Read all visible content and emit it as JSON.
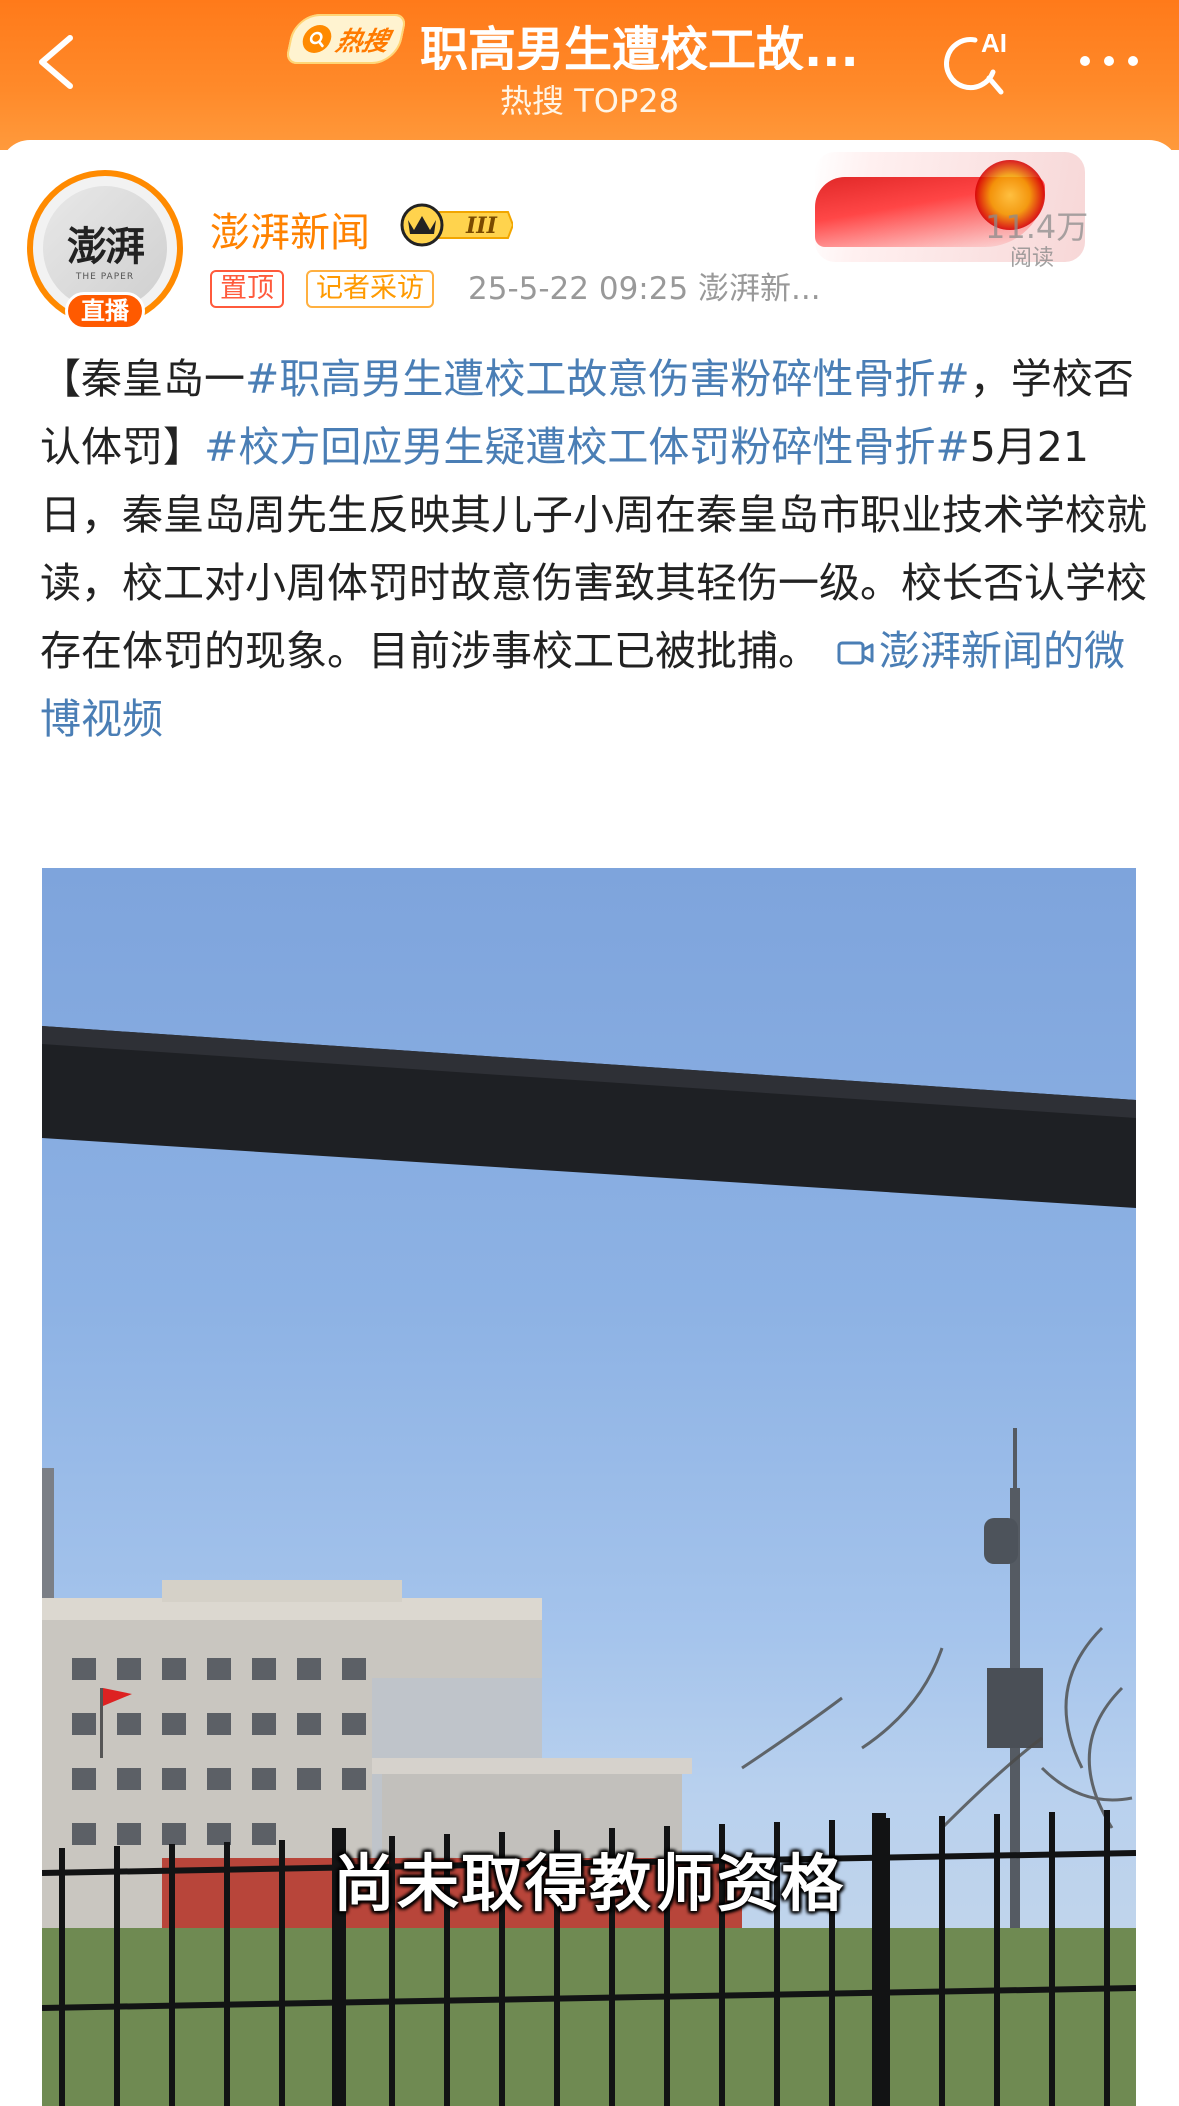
{
  "header": {
    "hot_badge": "热搜",
    "title": "职高男生遭校工故...",
    "subtitle": "热搜 TOP28",
    "ai_label": "AI"
  },
  "post": {
    "author": "澎湃新闻",
    "avatar_text": "澎湃",
    "avatar_subtext": "THE PAPER",
    "live_badge": "直播",
    "vip_level": "III",
    "tag_pin": "置顶",
    "tag_reporter": "记者采访",
    "meta": "25-5-22 09:25  澎湃新...",
    "read_count": "11.4万",
    "read_label": "阅读",
    "text": {
      "part1": "【秦皇岛一",
      "hashtag1": "#职高男生遭校工故意伤害粉碎性骨折#",
      "part2": "，学校否认体罚】",
      "hashtag2": "#校方回应男生疑遭校工体罚粉碎性骨折#",
      "part3": "5月21日，秦皇岛周先生反映其儿子小周在秦皇岛市职业技术学校就读，校工对小周体罚时故意伤害致其轻伤一级。校长否认学校存在体罚的现象。目前涉事校工已被批捕。",
      "video_link": "澎湃新闻的微博视频"
    },
    "video_caption": "尚未取得教师资格"
  }
}
